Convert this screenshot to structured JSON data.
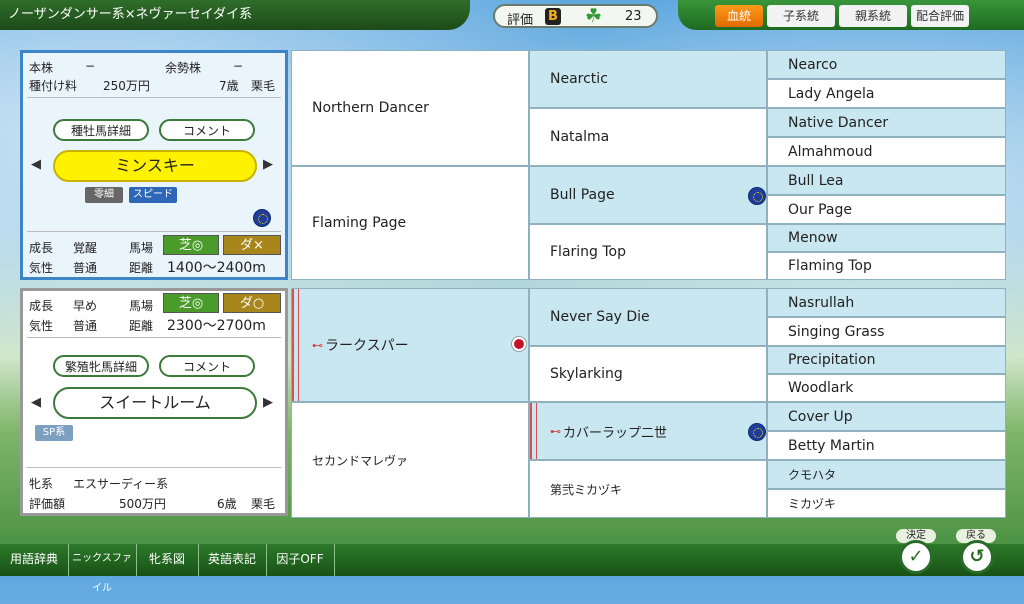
{
  "header": {
    "cross": "ノーザンダンサー系×ネヴァーセイダイ系",
    "eval_label": "評価",
    "grade": "B",
    "clover_count": "23",
    "tabs": [
      "血統",
      "子系統",
      "親系統",
      "配合評価"
    ],
    "active_tab": "血統"
  },
  "sire_panel": {
    "line1_a": "本株",
    "line1_a_val": "−",
    "line1_b": "余勢株",
    "line1_b_val": "−",
    "fee_label": "種付け料",
    "fee": "250万円",
    "age": "7歳",
    "coat": "栗毛",
    "detail_btn": "種牡馬詳細",
    "comment_btn": "コメント",
    "name": "ミンスキー",
    "chip1": "零細",
    "chip2": "スピード",
    "growth_label": "成長",
    "growth": "覚醒",
    "track_label": "馬場",
    "turf": "芝◎",
    "dirt": "ダ×",
    "temper_label": "気性",
    "temper": "普通",
    "dist_label": "距離",
    "dist": "1400〜2400m"
  },
  "dam_panel": {
    "growth_label": "成長",
    "growth": "早め",
    "track_label": "馬場",
    "turf": "芝◎",
    "dirt": "ダ○",
    "temper_label": "気性",
    "temper": "普通",
    "dist_label": "距離",
    "dist": "2300〜2700m",
    "detail_btn": "繁殖牝馬詳細",
    "comment_btn": "コメント",
    "name": "スイートルーム",
    "chip": "SP系",
    "line_label": "牝系",
    "line": "エスサーディー系",
    "value_label": "評価額",
    "value": "500万円",
    "age": "6歳",
    "coat": "栗毛"
  },
  "pedigree": {
    "g1": [
      "Northern Dancer",
      "Flaming Page",
      "ラークスパー",
      "セカンドマレヴァ"
    ],
    "g2": [
      "Nearctic",
      "Natalma",
      "Bull Page",
      "Flaring Top",
      "Never Say Die",
      "Skylarking",
      "カバーラップ二世",
      "第弐ミカヅキ"
    ],
    "g3": [
      "Nearco",
      "Lady Angela",
      "Native Dancer",
      "Almahmoud",
      "Bull Lea",
      "Our Page",
      "Menow",
      "Flaming Top",
      "Nasrullah",
      "Singing Grass",
      "Precipitation",
      "Woodlark",
      "Cover Up",
      "Betty Martin",
      "クモハタ",
      "ミカヅキ"
    ]
  },
  "footer": {
    "items": [
      "用語辞典",
      "ニックスファイル",
      "牝系図",
      "英語表記",
      "因子OFF"
    ],
    "ok_label": "決定",
    "back_label": "戻る"
  },
  "colors": {
    "accent_green": "#2f6e2a",
    "cell_blue": "#c9e7f1",
    "active_tab": "#f08a10",
    "sire_name_bg": "#fff200"
  }
}
